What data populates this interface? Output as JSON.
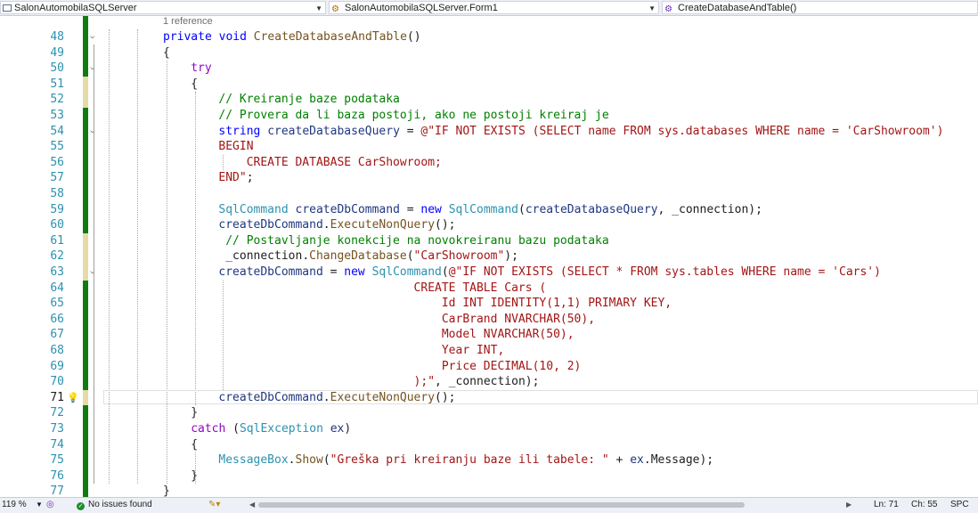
{
  "navbar": {
    "project": "SalonAutomobilaSQLServer",
    "class": "SalonAutomobilaSQLServer.Form1",
    "member": "CreateDatabaseAndTable()"
  },
  "editor": {
    "reference_hint": "1 reference",
    "lines": [
      {
        "num": "48",
        "tokens": [
          [
            "kw",
            "private"
          ],
          [
            "",
            " "
          ],
          [
            "kw",
            "void"
          ],
          [
            "",
            " "
          ],
          [
            "me",
            "CreateDatabaseAndTable"
          ],
          [
            "",
            "()"
          ]
        ]
      },
      {
        "num": "49",
        "tokens": [
          [
            "",
            "{"
          ]
        ]
      },
      {
        "num": "50",
        "tokens": [
          [
            "cf",
            "try"
          ]
        ]
      },
      {
        "num": "51",
        "tokens": [
          [
            "",
            "{"
          ]
        ]
      },
      {
        "num": "52",
        "tokens": [
          [
            "cm",
            "// Kreiranje baze podataka"
          ]
        ]
      },
      {
        "num": "53",
        "tokens": [
          [
            "cm",
            "// Provera da li baza postoji, ako ne postoji kreiraj je"
          ]
        ]
      },
      {
        "num": "54",
        "tokens": [
          [
            "kw",
            "string"
          ],
          [
            "",
            " "
          ],
          [
            "pa",
            "createDatabaseQuery"
          ],
          [
            "",
            " = "
          ],
          [
            "st",
            "@\"IF NOT EXISTS (SELECT name FROM sys.databases WHERE name = 'CarShowroom')"
          ]
        ]
      },
      {
        "num": "55",
        "tokens": [
          [
            "st",
            "BEGIN"
          ]
        ]
      },
      {
        "num": "56",
        "tokens": [
          [
            "st",
            "    CREATE DATABASE CarShowroom;"
          ]
        ]
      },
      {
        "num": "57",
        "tokens": [
          [
            "st",
            "END\""
          ],
          [
            "",
            ";"
          ]
        ]
      },
      {
        "num": "58",
        "tokens": []
      },
      {
        "num": "59",
        "tokens": [
          [
            "ty",
            "SqlCommand"
          ],
          [
            "",
            " "
          ],
          [
            "pa",
            "createDbCommand"
          ],
          [
            "",
            " = "
          ],
          [
            "kw",
            "new"
          ],
          [
            "",
            " "
          ],
          [
            "ty",
            "SqlCommand"
          ],
          [
            "",
            "("
          ],
          [
            "pa",
            "createDatabaseQuery"
          ],
          [
            "",
            ", "
          ],
          [
            "fi",
            "_connection"
          ],
          [
            "",
            ");"
          ]
        ]
      },
      {
        "num": "60",
        "tokens": [
          [
            "pa",
            "createDbCommand"
          ],
          [
            "",
            "."
          ],
          [
            "me",
            "ExecuteNonQuery"
          ],
          [
            "",
            "();"
          ]
        ]
      },
      {
        "num": "61",
        "tokens": [
          [
            "",
            " "
          ],
          [
            "cm",
            "// Postavljanje konekcije na novokreiranu bazu podataka"
          ]
        ]
      },
      {
        "num": "62",
        "tokens": [
          [
            "",
            " "
          ],
          [
            "fi",
            "_connection"
          ],
          [
            "",
            "."
          ],
          [
            "me",
            "ChangeDatabase"
          ],
          [
            "",
            "("
          ],
          [
            "st",
            "\"CarShowroom\""
          ],
          [
            "",
            ");"
          ]
        ]
      },
      {
        "num": "63",
        "tokens": [
          [
            "pa",
            "createDbCommand"
          ],
          [
            "",
            " = "
          ],
          [
            "kw",
            "new"
          ],
          [
            "",
            " "
          ],
          [
            "ty",
            "SqlCommand"
          ],
          [
            "",
            "("
          ],
          [
            "st",
            "@\"IF NOT EXISTS (SELECT * FROM sys.tables WHERE name = 'Cars')"
          ]
        ]
      },
      {
        "num": "64",
        "tokens": [
          [
            "st",
            "                            CREATE TABLE Cars ("
          ]
        ]
      },
      {
        "num": "65",
        "tokens": [
          [
            "st",
            "                                Id INT IDENTITY(1,1) PRIMARY KEY,"
          ]
        ]
      },
      {
        "num": "66",
        "tokens": [
          [
            "st",
            "                                CarBrand NVARCHAR(50),"
          ]
        ]
      },
      {
        "num": "67",
        "tokens": [
          [
            "st",
            "                                Model NVARCHAR(50),"
          ]
        ]
      },
      {
        "num": "68",
        "tokens": [
          [
            "st",
            "                                Year INT,"
          ]
        ]
      },
      {
        "num": "69",
        "tokens": [
          [
            "st",
            "                                Price DECIMAL(10, 2)"
          ]
        ]
      },
      {
        "num": "70",
        "tokens": [
          [
            "st",
            "                            );\""
          ],
          [
            "",
            ", "
          ],
          [
            "fi",
            "_connection"
          ],
          [
            "",
            ");"
          ]
        ]
      },
      {
        "num": "71",
        "tokens": [
          [
            "pa",
            "createDbCommand"
          ],
          [
            "",
            "."
          ],
          [
            "me",
            "ExecuteNonQuery"
          ],
          [
            "",
            "();"
          ]
        ]
      },
      {
        "num": "72",
        "tokens": [
          [
            "",
            "}"
          ]
        ]
      },
      {
        "num": "73",
        "tokens": [
          [
            "cf",
            "catch"
          ],
          [
            "",
            " ("
          ],
          [
            "ty",
            "SqlException"
          ],
          [
            "",
            " "
          ],
          [
            "pa",
            "ex"
          ],
          [
            "",
            ")"
          ]
        ]
      },
      {
        "num": "74",
        "tokens": [
          [
            "",
            "{"
          ]
        ]
      },
      {
        "num": "75",
        "tokens": [
          [
            "ty",
            "MessageBox"
          ],
          [
            "",
            "."
          ],
          [
            "me",
            "Show"
          ],
          [
            "",
            "("
          ],
          [
            "st",
            "\"Greška pri kreiranju baze ili tabele: \""
          ],
          [
            "",
            " + "
          ],
          [
            "pa",
            "ex"
          ],
          [
            "",
            "."
          ],
          [
            "",
            "Message"
          ],
          [
            "",
            ");"
          ]
        ]
      },
      {
        "num": "76",
        "tokens": [
          [
            "",
            "}"
          ]
        ]
      },
      {
        "num": "77",
        "tokens": [
          [
            "",
            "}"
          ]
        ]
      }
    ],
    "current_line": "71"
  },
  "status": {
    "zoom": "119 %",
    "issues": "No issues found",
    "ln": "Ln: 71",
    "ch": "Ch: 55",
    "mode": "SPC"
  },
  "colors": {
    "keyword": "#0000ff",
    "control": "#8f08c4",
    "type": "#2b91af",
    "method": "#74531f",
    "comment": "#008000",
    "string": "#a31515",
    "local": "#1f377f",
    "change_bar": "#107c10"
  }
}
